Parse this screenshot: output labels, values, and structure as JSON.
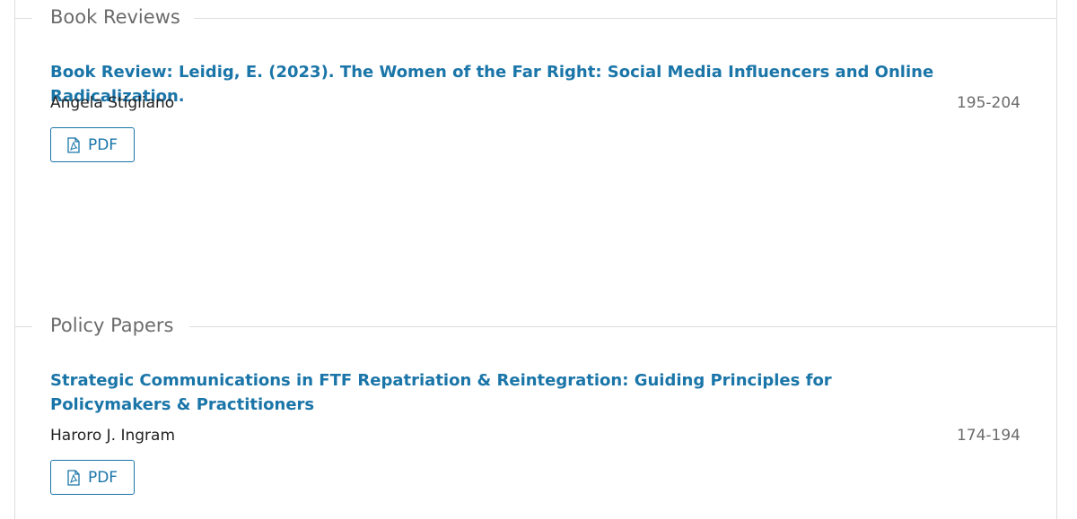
{
  "sections": [
    {
      "title": "Book Reviews",
      "articles": [
        {
          "title": "Book Review: Leidig, E. (2023). The Women of the Far Right: Social Media Influencers and Online Radicalization.",
          "author": "Angela Stigliano",
          "pages": "195-204",
          "galley_label": "PDF"
        }
      ]
    },
    {
      "title": "Policy Papers",
      "articles": [
        {
          "title": "Strategic Communications in FTF Repatriation & Reintegration: Guiding Principles for Policymakers & Practitioners",
          "author": "Haroro J. Ingram",
          "pages": "174-194",
          "galley_label": "PDF"
        }
      ]
    }
  ],
  "colors": {
    "link": "#1a75a8",
    "muted": "#6b6b6b",
    "rule": "#dddddd"
  },
  "icons": {
    "galley": "file-pdf-icon"
  }
}
